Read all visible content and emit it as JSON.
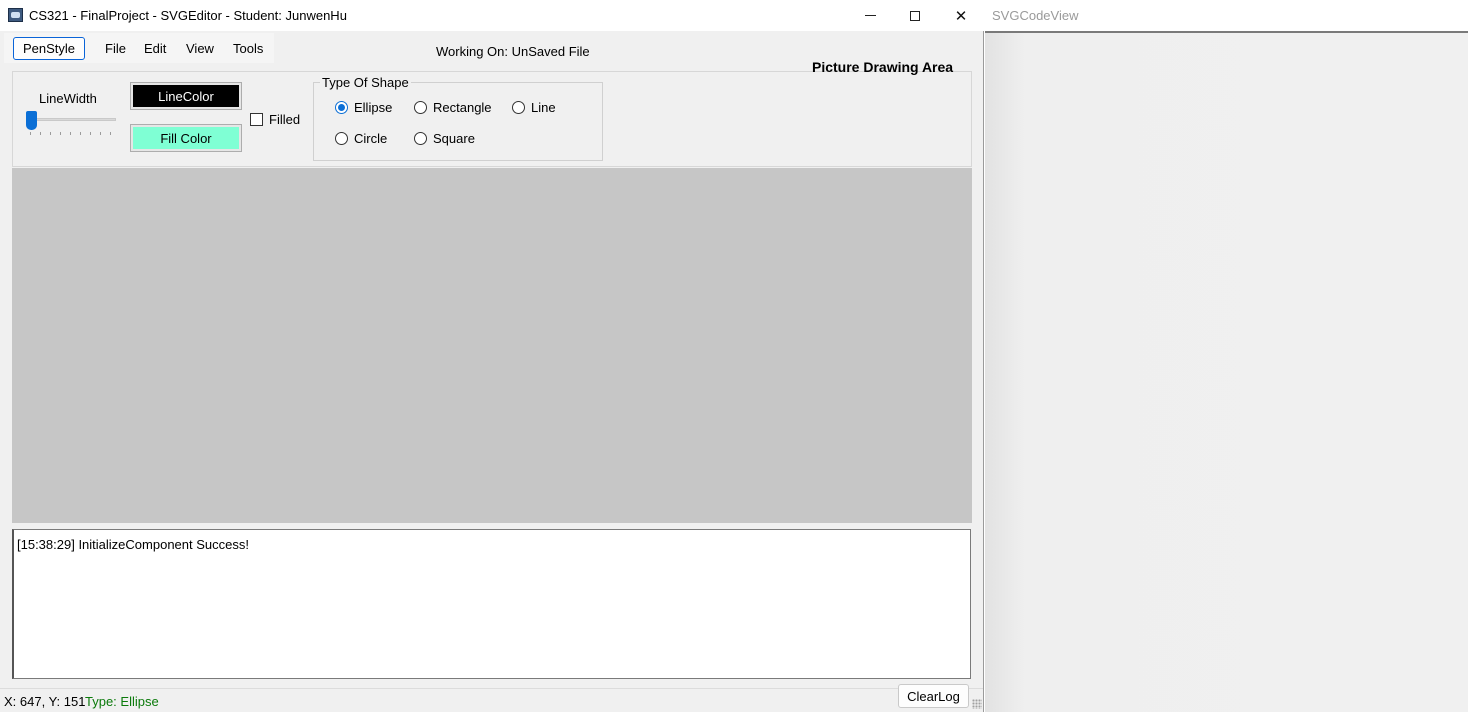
{
  "window": {
    "title": "CS321 - FinalProject - SVGEditor - Student: JunwenHu",
    "minimize_symbol": "",
    "close_symbol": "✕"
  },
  "menu": {
    "items": [
      "PenStyle",
      "File",
      "Edit",
      "View",
      "Tools"
    ],
    "selected": "PenStyle"
  },
  "working_on": "Working On: UnSaved File",
  "drawing_area_title": "Picture Drawing Area",
  "pen_style": {
    "line_width_label": "LineWidth",
    "line_width_value": 1,
    "line_color_label": "LineColor",
    "fill_color_label": "Fill Color",
    "filled_label": "Filled",
    "filled_checked": false,
    "colors": {
      "line_color": "#000000",
      "fill_color": "#7fffd4"
    }
  },
  "shape_type": {
    "legend": "Type Of Shape",
    "options": [
      "Ellipse",
      "Rectangle",
      "Line",
      "Circle",
      "Square"
    ],
    "selected": "Ellipse"
  },
  "log": {
    "lines": [
      "[15:38:29] InitializeComponent Success!"
    ]
  },
  "status": {
    "coords": "X: 647, Y: 151",
    "type": "Type: Ellipse",
    "clear_log_label": "ClearLog"
  },
  "code_view": {
    "title": "SVGCodeView"
  },
  "colors": {
    "canvas": "#c6c6c6",
    "accent": "#0b6fd6",
    "status_type": "#0b7a0b"
  }
}
